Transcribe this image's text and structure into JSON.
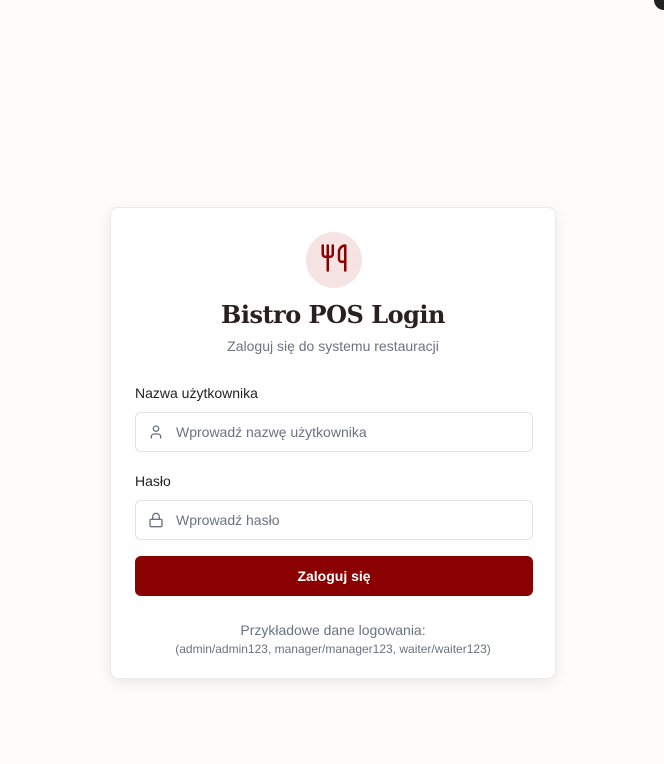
{
  "login": {
    "logo_icon": "utensils-icon",
    "accent_color": "#8b0000",
    "title": "Bistro POS Login",
    "subtitle": "Zaloguj się do systemu restauracji",
    "username": {
      "label": "Nazwa użytkownika",
      "placeholder": "Wprowadź nazwę użytkownika",
      "value": "",
      "icon": "user-icon"
    },
    "password": {
      "label": "Hasło",
      "placeholder": "Wprowadź hasło",
      "value": "",
      "icon": "lock-icon"
    },
    "submit_label": "Zaloguj się",
    "demo_heading": "Przykładowe dane logowania:",
    "demo_credentials": "(admin/admin123, manager/manager123, waiter/waiter123)"
  }
}
